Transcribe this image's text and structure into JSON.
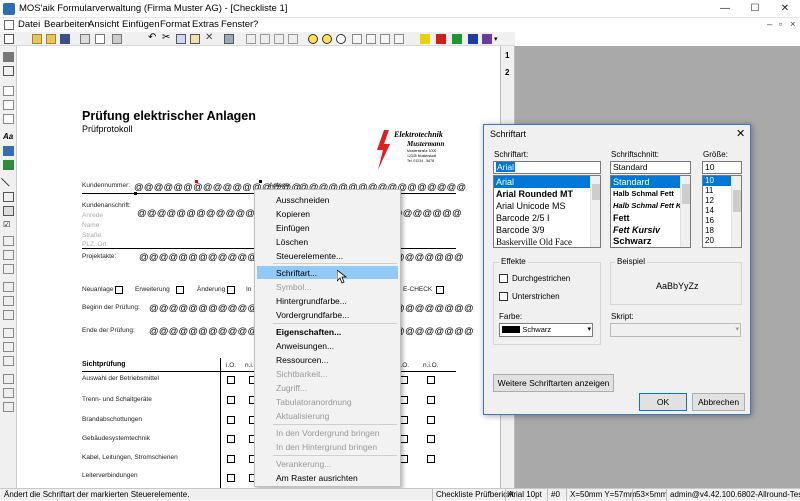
{
  "window": {
    "title": "MOS'aik Formularverwaltung (Firma Muster AG) - [Checkliste 1]",
    "min": "—",
    "max": "☐",
    "close": "✕"
  },
  "menu": [
    "Datei",
    "Bearbeiten",
    "Ansicht",
    "Einfügen",
    "Format",
    "Extras",
    "Fenster",
    "?"
  ],
  "ruler": [
    "1",
    "2"
  ],
  "form": {
    "title": "Prüfung elektrischer Anlagen",
    "subtitle": "Prüfprotokoll",
    "logo_name": "Elektrotechnik",
    "logo_sub": "Mustermann",
    "logo_small": [
      "Musterstraße 1000",
      "12345 Musterstadt",
      "Tel. 01234 - 5678"
    ],
    "kundennummer": "Kundennummer:",
    "anlage": "Anlage:",
    "kundenanschrift": "Kundenanschrift:",
    "addr_fields": [
      "Anrede",
      "Name",
      "Straße",
      "PLZ, Ort"
    ],
    "projektakte": "Projektakte:",
    "checks": [
      "Neuanlage",
      "Erweiterung",
      "Änderung",
      "In",
      "E-CHECK"
    ],
    "beginn": "Beginn der Prüfung:",
    "ende": "Ende der Prüfung:",
    "placeholder": "@@@@@@@@@@@@@@@@@",
    "placeholder_long": "@@@@@@@@@@@@@@@@@@@@@@@@@@@@@@@@@",
    "table_header": "Sichtprüfung",
    "col_io": "i.O.",
    "col_nio": "n.i.O.",
    "rows": [
      "Auswahl der Betriebsmittel",
      "Trenn- und Schaltgeräte",
      "Brandabschottungen",
      "Gebäudesystemtechnik",
      "Kabel, Leitungen, Stromschienen",
      "Leiterverbindungen"
    ]
  },
  "context_menu": {
    "items": [
      {
        "label": "Ausschneiden",
        "state": "normal"
      },
      {
        "label": "Kopieren",
        "state": "normal"
      },
      {
        "label": "Einfügen",
        "state": "normal"
      },
      {
        "label": "Löschen",
        "state": "normal"
      },
      {
        "label": "Steuerelemente...",
        "state": "normal"
      },
      {
        "label": "Schriftart...",
        "state": "highlight"
      },
      {
        "label": "Symbol...",
        "state": "disabled"
      },
      {
        "label": "Hintergrundfarbe...",
        "state": "normal"
      },
      {
        "label": "Vordergrundfarbe...",
        "state": "normal"
      },
      {
        "label": "Eigenschaften...",
        "state": "bold"
      },
      {
        "label": "Anweisungen...",
        "state": "normal"
      },
      {
        "label": "Ressourcen...",
        "state": "normal"
      },
      {
        "label": "Sichtbarkeit...",
        "state": "disabled"
      },
      {
        "label": "Zugriff...",
        "state": "disabled"
      },
      {
        "label": "Tabulatoranordnung",
        "state": "disabled"
      },
      {
        "label": "Aktualisierung",
        "state": "disabled"
      },
      {
        "label": "In den Vordergrund bringen",
        "state": "disabled"
      },
      {
        "label": "In den Hintergrund bringen",
        "state": "disabled"
      },
      {
        "label": "Verankerung...",
        "state": "disabled"
      },
      {
        "label": "Am Raster ausrichten",
        "state": "normal"
      }
    ]
  },
  "dialog": {
    "title": "Schriftart",
    "close": "✕",
    "font_label": "Schriftart:",
    "font_value": "Arial",
    "fonts": [
      "Arial",
      "Arial Rounded MT",
      "Arial Unicode MS",
      "Barcode 2/5 I",
      "Barcode 3/9",
      "Baskerville Old Face"
    ],
    "style_label": "Schriftschnitt:",
    "style_value": "Standard",
    "styles": [
      "Standard",
      "Halb Schmal Fett",
      "Halb Schmal Fett Ku",
      "Fett",
      "Fett Kursiv",
      "Schwarz"
    ],
    "size_label": "Größe:",
    "size_value": "10",
    "sizes": [
      "10",
      "11",
      "12",
      "14",
      "16",
      "18",
      "20"
    ],
    "effects_label": "Effekte",
    "strike_label": "Durchgestrichen",
    "underline_label": "Unterstrichen",
    "color_label": "Farbe:",
    "color_value": "Schwarz",
    "sample_label": "Beispiel",
    "sample_text": "AaBbYyZz",
    "script_label": "Skript:",
    "more_fonts": "Weitere Schriftarten anzeigen",
    "ok": "OK",
    "cancel": "Abbrechen"
  },
  "status": {
    "hint": "Ändert die Schriftart der markierten Steuerelemente.",
    "doc": "Checkliste Prüfbericht",
    "font": "Arial 10pt",
    "num": "#0",
    "coords": "X=50mm Y=57mm",
    "size": "53×5mm",
    "user": "admin@v4.42.100.6802-Allround-Test"
  }
}
